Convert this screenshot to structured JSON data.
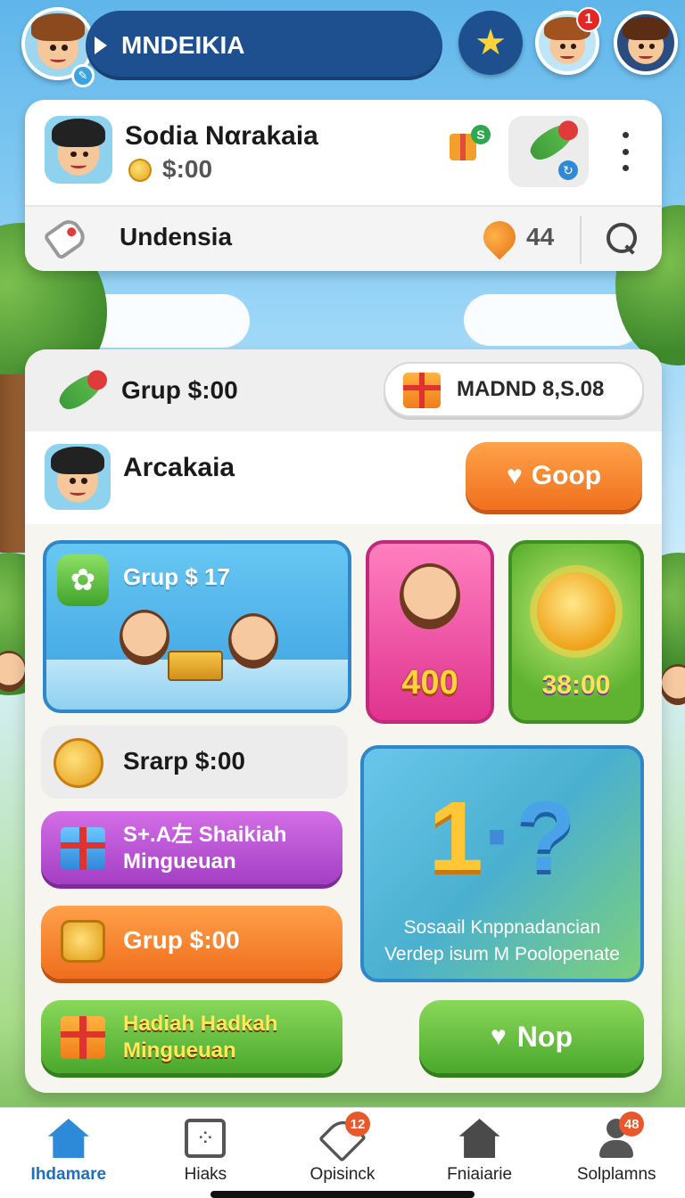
{
  "header": {
    "title": "MNDEIKIA",
    "notification_count": "1"
  },
  "profile": {
    "name": "Sodia Nαrakaia",
    "balance": "$:00",
    "gift_badge": "S",
    "region": "Undensia",
    "likes_count": "44"
  },
  "panel": {
    "group_balance": "Grup $:00",
    "madnd_label": "MADND 8,S.08",
    "member_name": "Arcakaia",
    "goop_label": "Goop"
  },
  "tiles": {
    "group_tile_label": "Grup $ 17",
    "pink_value": "400",
    "green_value": "38:00",
    "sraap_label": "Srarp $:00",
    "purple_btn": [
      "S+.A左 Shaikiah",
      "Mingueuan"
    ],
    "orange_btn": "Grup $:00",
    "green_btn": [
      "Hadiah Hadkah",
      "Mingueuan"
    ],
    "quiz_number_left": "1",
    "quiz_number_mid": "·",
    "quiz_number_right": "?",
    "quiz_caption": [
      "Sosaail Knppnadancian",
      "Verdep isum M Poolopenate"
    ],
    "nop_label": "Nop"
  },
  "bottom_nav": {
    "items": [
      {
        "label": "Ihdamare",
        "icon": "home-icon",
        "active": true
      },
      {
        "label": "Hiaks",
        "icon": "calendar-icon"
      },
      {
        "label": "Opisinck",
        "icon": "tag-icon",
        "badge": "12"
      },
      {
        "label": "Fniaiarie",
        "icon": "house-icon"
      },
      {
        "label": "Solplamns",
        "icon": "user-icon",
        "badge": "48"
      }
    ]
  },
  "colors": {
    "primary_navy": "#1e4f8e",
    "accent_orange": "#f0701d",
    "accent_green": "#4aa82c",
    "accent_purple": "#a43fc4",
    "active_nav": "#1e6fbf"
  }
}
